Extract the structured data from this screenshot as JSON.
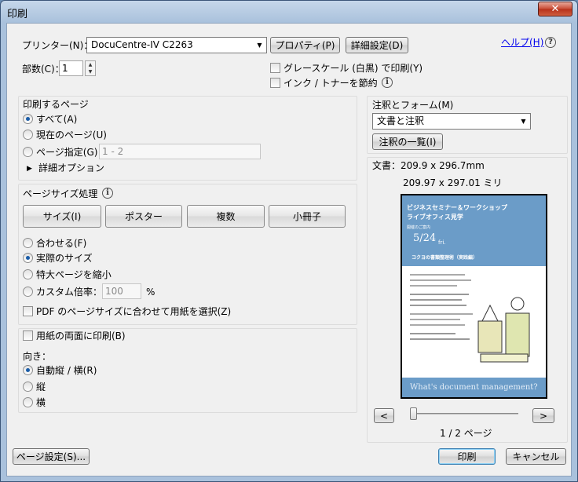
{
  "window": {
    "title": "印刷",
    "close_symbol": "✕"
  },
  "printer": {
    "label": "プリンター(N)：",
    "selected": "DocuCentre-IV C2263",
    "properties_button": "プロパティ(P)",
    "advanced_button": "詳細設定(D)",
    "help_link": "ヘルプ(H)",
    "help_icon": "?"
  },
  "copies": {
    "label": "部数(C)：",
    "value": "1"
  },
  "options": {
    "grayscale": {
      "label": "グレースケール (白黒) で印刷(Y)",
      "checked": false
    },
    "save_ink": {
      "label": "インク / トナーを節約",
      "checked": false
    }
  },
  "pages_section": {
    "title": "印刷するページ",
    "all": "すべて(A)",
    "current": "現在のページ(U)",
    "range": "ページ指定(G)",
    "range_placeholder": "1 - 2",
    "more_options": "詳細オプション",
    "selected": "all"
  },
  "size_section": {
    "title": "ページサイズ処理",
    "buttons": [
      "サイズ(I)",
      "ポスター",
      "複数",
      "小冊子"
    ],
    "fit": "合わせる(F)",
    "actual": "実際のサイズ",
    "shrink": "特大ページを縮小",
    "custom": "カスタム倍率：",
    "custom_value": "100",
    "percent": "%",
    "pdf_paper": "PDF のページサイズに合わせて用紙を選択(Z)",
    "selected": "actual"
  },
  "duplex": {
    "label": "用紙の両面に印刷(B)",
    "checked": false
  },
  "orientation": {
    "title": "向き：",
    "auto": "自動縦 / 横(R)",
    "portrait": "縦",
    "landscape": "横",
    "selected": "auto"
  },
  "comments": {
    "title": "注釈とフォーム(M)",
    "selected": "文書と注釈",
    "summary_button": "注釈の一覧(I)"
  },
  "preview": {
    "document_size": "文書：209.9 x 296.7mm",
    "paper_size": "209.97 x 297.01 ミリ",
    "doc_heading1": "ビジネスセミナー＆ワークショップ",
    "doc_heading2": "ライブオフィス見学",
    "doc_subheading": "開催のご案内",
    "doc_date": "5/24",
    "doc_day": "fri.",
    "doc_topic": "コクヨの書類整理術（実践編）",
    "doc_footer": "What's document management?",
    "prev_button": "<",
    "next_button": ">",
    "page_indicator": "1 / 2 ページ",
    "blue": "#6b9cc8"
  },
  "footer": {
    "page_setup_button": "ページ設定(S)...",
    "print_button": "印刷",
    "cancel_button": "キャンセル"
  }
}
